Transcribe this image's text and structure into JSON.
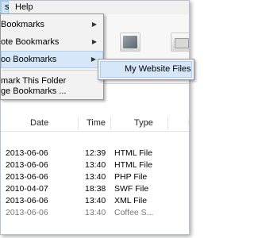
{
  "menubar": {
    "active_label": "s",
    "help_label": "Help"
  },
  "main_menu": {
    "items": [
      {
        "label": "Bookmarks",
        "has_submenu": true
      },
      {
        "label": "ote Bookmarks",
        "has_submenu": true
      },
      {
        "label": "oo Bookmarks",
        "has_submenu": true,
        "highlighted": true
      },
      {
        "label": "mark This Folder",
        "has_submenu": false
      },
      {
        "label": "ge Bookmarks ...",
        "has_submenu": false
      }
    ]
  },
  "submenu": {
    "items": [
      {
        "label": "My Website Files"
      }
    ]
  },
  "list": {
    "headers": {
      "date": "Date",
      "time": "Time",
      "type": "Type",
      "extra": "F"
    },
    "rows": [
      {
        "date": "2013-06-06",
        "time": "12:39",
        "type": "HTML File"
      },
      {
        "date": "2013-06-06",
        "time": "13:40",
        "type": "HTML File"
      },
      {
        "date": "2013-06-06",
        "time": "13:40",
        "type": "PHP File"
      },
      {
        "date": "2010-04-07",
        "time": "18:38",
        "type": "SWF File"
      },
      {
        "date": "2013-06-06",
        "time": "13:40",
        "type": "XML File"
      },
      {
        "date": "2013-06-06",
        "time": "13:40",
        "type": "Coffee S..."
      }
    ]
  },
  "colors": {
    "menu_highlight": "#d5e7f8",
    "menu_bg": "#f2f2f2"
  }
}
